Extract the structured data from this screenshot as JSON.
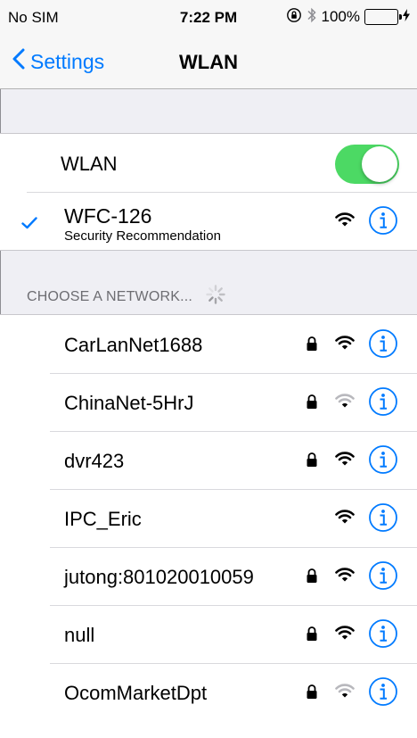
{
  "status_bar": {
    "carrier": "No SIM",
    "time": "7:22 PM",
    "battery": "100%"
  },
  "nav": {
    "back_label": "Settings",
    "title": "WLAN"
  },
  "wlan_toggle": {
    "label": "WLAN",
    "on": true
  },
  "connected": {
    "name": "WFC-126",
    "subtitle": "Security Recommendation"
  },
  "section": {
    "header": "CHOOSE A NETWORK..."
  },
  "networks": [
    {
      "name": "CarLanNet1688",
      "locked": true,
      "signal": "strong"
    },
    {
      "name": "ChinaNet-5HrJ",
      "locked": true,
      "signal": "weak"
    },
    {
      "name": "dvr423",
      "locked": true,
      "signal": "strong"
    },
    {
      "name": "IPC_Eric",
      "locked": false,
      "signal": "strong"
    },
    {
      "name": "jutong:801020010059",
      "locked": true,
      "signal": "strong"
    },
    {
      "name": "null",
      "locked": true,
      "signal": "strong"
    },
    {
      "name": "OcomMarketDpt",
      "locked": true,
      "signal": "weak"
    }
  ],
  "colors": {
    "accent": "#007aff",
    "toggle_on": "#4cd964",
    "background": "#efeff4"
  },
  "icons": [
    "chevron-left-icon",
    "checkmark-icon",
    "lock-icon",
    "wifi-icon",
    "info-icon",
    "spinner-icon",
    "bluetooth-icon",
    "orientation-lock-icon",
    "battery-icon"
  ]
}
